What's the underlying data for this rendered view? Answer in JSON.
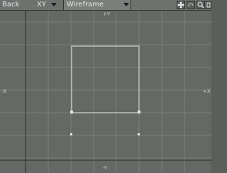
{
  "toolbar": {
    "view_label": "Back",
    "axis_label": "XY",
    "mode_label": "Wireframe"
  },
  "viewport": {
    "axis_top": "+Y",
    "axis_bottom": "-Y",
    "axis_left": "-X",
    "axis_right": "+X",
    "colors": {
      "bg": "#656965",
      "grid": "#7a7e7a",
      "axis": "#2a2d2a",
      "selection": "#e8ece8"
    }
  }
}
